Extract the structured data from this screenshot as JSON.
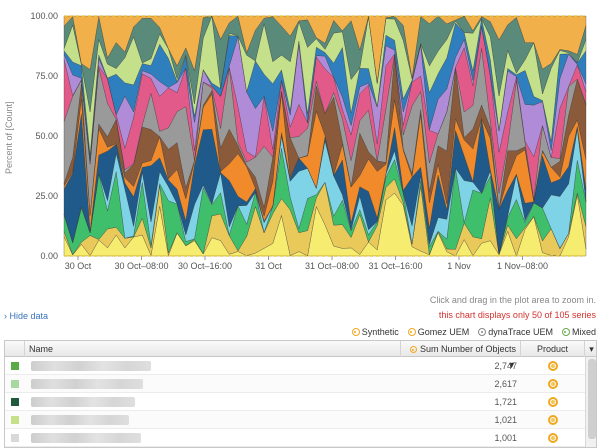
{
  "chart_data": {
    "type": "area",
    "ylabel": "Percent of [Count]",
    "ylim": [
      0,
      100
    ],
    "yticks": [
      "0.00",
      "25.00",
      "50.00",
      "75.00",
      "100.00"
    ],
    "xtick_labels": [
      "30 Oct",
      "30 Oct–08:00",
      "30 Oct–16:00",
      "31 Oct",
      "31 Oct–08:00",
      "31 Oct–16:00",
      "1 Nov",
      "1 Nov–08:00"
    ],
    "grid": true,
    "stacked": true,
    "series_palette": [
      "#f6ec6f",
      "#e8c95a",
      "#3fbf6b",
      "#7fd3e6",
      "#1f5a8a",
      "#f08a2a",
      "#8a5a3a",
      "#9a9a9a",
      "#e25a8a",
      "#b08cd8",
      "#2f7fbf",
      "#c4e08a",
      "#5a8a7a",
      "#f2b04a"
    ]
  },
  "ui": {
    "zoom_hint": "Click and drag in the plot area to zoom in.",
    "series_note": "this chart displays only 50 of 105 series",
    "hide_data": "› Hide data",
    "legend": [
      {
        "label": "Synthetic",
        "color": "#f0a81e",
        "icon": "synthetic-icon"
      },
      {
        "label": "Gomez UEM",
        "color": "#f0a81e",
        "icon": "gomez-uem-icon"
      },
      {
        "label": "dynaTrace UEM",
        "color": "#888888",
        "icon": "dynatrace-uem-icon"
      },
      {
        "label": "Mixed",
        "color": "#6aa84f",
        "icon": "mixed-icon"
      }
    ]
  },
  "table": {
    "headers": {
      "name": "Name",
      "sum": "Sum Number of Objects ▼",
      "product": "Product"
    },
    "rows": [
      {
        "swatch": "#5aaa4a",
        "value": "2,747",
        "product_icon": "synthetic-icon"
      },
      {
        "swatch": "#a8d8a0",
        "value": "2,617",
        "product_icon": "synthetic-icon"
      },
      {
        "swatch": "#1f5a3a",
        "value": "1,721",
        "product_icon": "synthetic-icon"
      },
      {
        "swatch": "#c4e08a",
        "value": "1,021",
        "product_icon": "synthetic-icon"
      },
      {
        "swatch": "#d8d8d8",
        "value": "1,001",
        "product_icon": "synthetic-icon"
      }
    ]
  }
}
